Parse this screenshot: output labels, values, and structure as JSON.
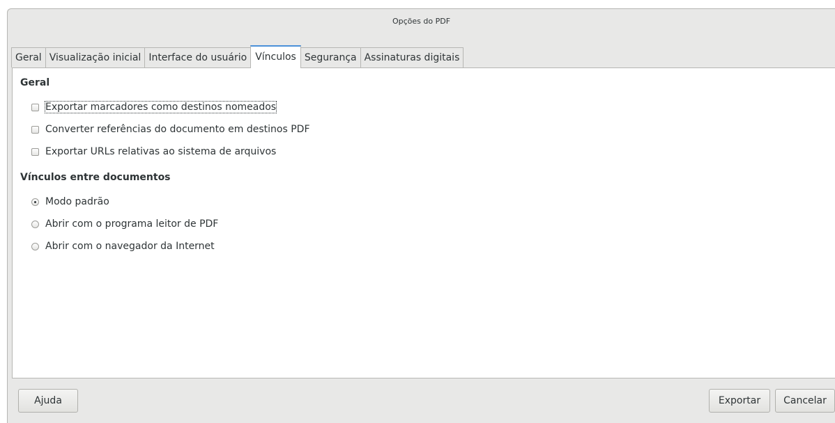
{
  "window": {
    "title": "Opções do PDF"
  },
  "tabs": [
    {
      "label": "Geral",
      "active": false
    },
    {
      "label": "Visualização inicial",
      "active": false
    },
    {
      "label": "Interface do usuário",
      "active": false
    },
    {
      "label": "Vínculos",
      "active": true
    },
    {
      "label": "Segurança",
      "active": false
    },
    {
      "label": "Assinaturas digitais",
      "active": false
    }
  ],
  "general": {
    "title": "Geral",
    "options": [
      {
        "label": "Exportar marcadores como destinos nomeados",
        "checked": false
      },
      {
        "label": "Converter referências do documento em destinos PDF",
        "checked": false
      },
      {
        "label": "Exportar URLs relativas ao sistema de arquivos",
        "checked": false
      }
    ]
  },
  "cross_document": {
    "title": "Vínculos entre documentos",
    "options": [
      {
        "label": "Modo padrão",
        "selected": true
      },
      {
        "label": "Abrir com o programa leitor de PDF",
        "selected": false
      },
      {
        "label": "Abrir com o navegador da Internet",
        "selected": false
      }
    ]
  },
  "buttons": {
    "help": "Ajuda",
    "export": "Exportar",
    "cancel": "Cancelar"
  },
  "colors": {
    "accent": "#4a90d9",
    "dialog_bg": "#e8e8e7",
    "content_bg": "#ffffff",
    "text": "#2e3436"
  }
}
